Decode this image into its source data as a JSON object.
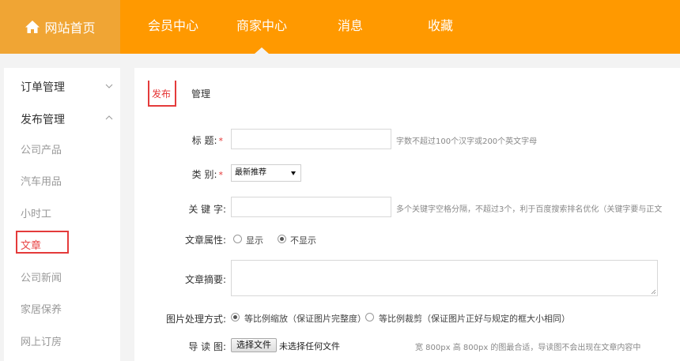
{
  "nav": {
    "home_label": "网站首页",
    "items": [
      "会员中心",
      "商家中心",
      "消息",
      "收藏"
    ],
    "active_index": 1,
    "colors": {
      "bar": "#ff9900",
      "home_bg": "#f0a534"
    }
  },
  "sidebar": {
    "groups": [
      {
        "label": "订单管理",
        "expanded": false
      },
      {
        "label": "发布管理",
        "expanded": true
      }
    ],
    "items": [
      "公司产品",
      "汽车用品",
      "小时工",
      "文章",
      "公司新闻",
      "家居保养",
      "网上订房"
    ],
    "active_item": "文章"
  },
  "tabs": {
    "publish": "发布",
    "manage": "管理",
    "active": "发布"
  },
  "form": {
    "title": {
      "label": "标  题:",
      "required_mark": "*",
      "value": "",
      "hint": "字数不超过100个汉字或200个英文字母"
    },
    "category": {
      "label": "类  别:",
      "required_mark": "*",
      "selected": "最新推荐"
    },
    "keywords": {
      "label": "关 键 字:",
      "value": "",
      "hint": "多个关键字空格分隔，不超过3个，利于百度搜索排名优化（关键字要与正文"
    },
    "attribute": {
      "label": "文章属性:",
      "options": [
        "显示",
        "不显示"
      ],
      "selected": "不显示"
    },
    "summary": {
      "label": "文章摘要:",
      "value": ""
    },
    "image_mode": {
      "label": "图片处理方式:",
      "options": [
        "等比例缩放（保证图片完整度）",
        "等比例裁剪（保证图片正好与规定的框大小相同）"
      ],
      "selected": "等比例缩放（保证图片完整度）"
    },
    "thumbnail": {
      "label": "导 读 图:",
      "button": "选择文件",
      "status": "未选择任何文件",
      "hint": "宽 800px 高 800px 的图最合适，导读图不会出现在文章内容中"
    }
  }
}
